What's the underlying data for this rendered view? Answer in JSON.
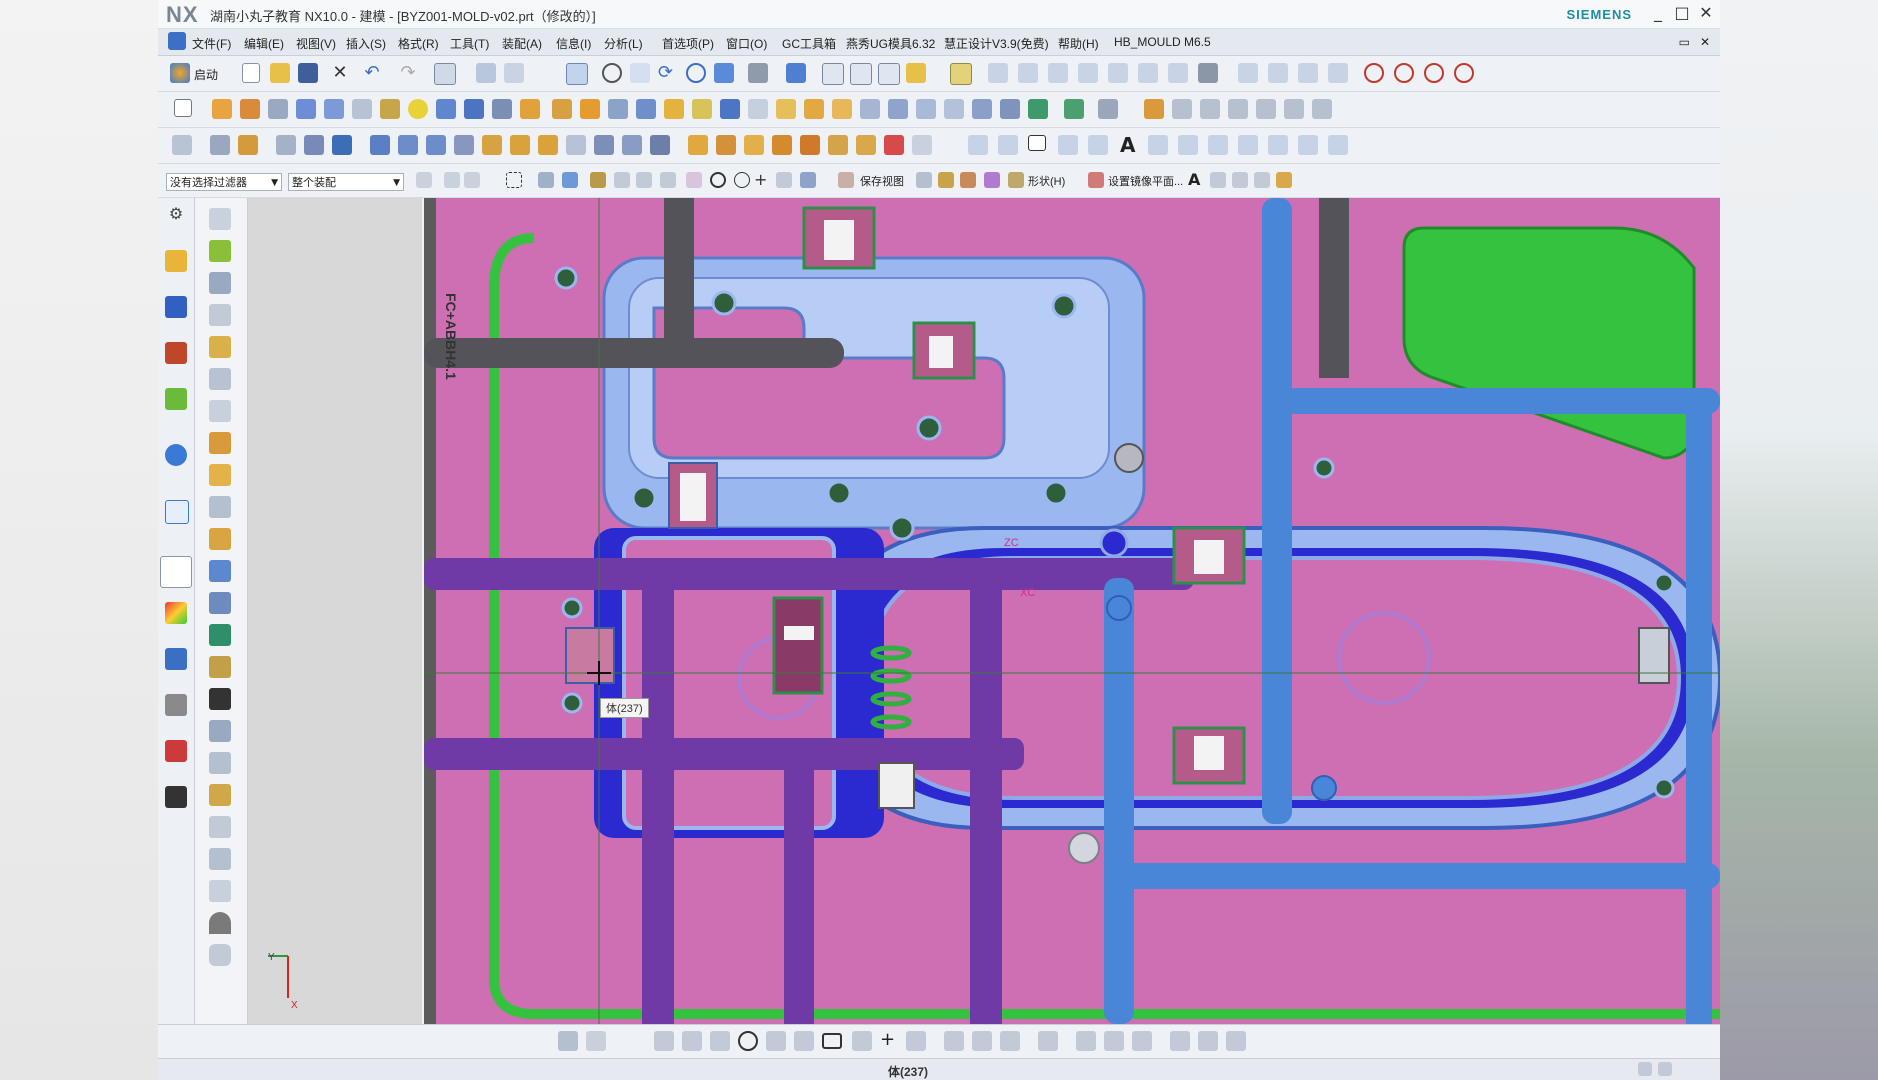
{
  "window": {
    "logo": "NX",
    "title": "湖南小丸子教育 NX10.0 - 建模 - [BYZ001-MOLD-v02.prt（修改的）]",
    "brand": "SIEMENS",
    "min_glyph": "_",
    "max_glyph": "□",
    "close_glyph": "✕"
  },
  "menubar": {
    "items": [
      "文件(F)",
      "编辑(E)",
      "视图(V)",
      "插入(S)",
      "格式(R)",
      "工具(T)",
      "装配(A)",
      "信息(I)",
      "分析(L)",
      "首选项(P)",
      "窗口(O)",
      "GC工具箱",
      "燕秀UG模具6.32",
      "慧正设计V3.9(免费)",
      "帮助(H)",
      "HB_MOULD M6.5"
    ],
    "restore_glyph": "▭",
    "close_glyph": "✕"
  },
  "toolbar": {
    "start_label": "启动",
    "selection_filter": "没有选择过滤器",
    "assembly_scope": "整个装配",
    "save_view_label": "保存视图",
    "shape_label": "形状(H)",
    "mirror_plane_label": "设置镜像平面...",
    "text_icon_glyph": "A"
  },
  "viewport": {
    "tooltip": "体(237)",
    "part_text": "FC+ABBH4.1",
    "axis_zc": "ZC",
    "axis_xc": "XC",
    "triad_y": "Y",
    "triad_x": "X"
  },
  "statusbar": {
    "text": "体(237)"
  },
  "colors": {
    "mold_plate": "#cd6fb2",
    "cavity_blue": "#9ab8ef",
    "runner_purple": "#6f3aa6",
    "cooling_blue": "#4a86d8",
    "channel_green": "#35c23f",
    "insert_navy": "#2a2ad0",
    "pipe_gray": "#55535a"
  }
}
